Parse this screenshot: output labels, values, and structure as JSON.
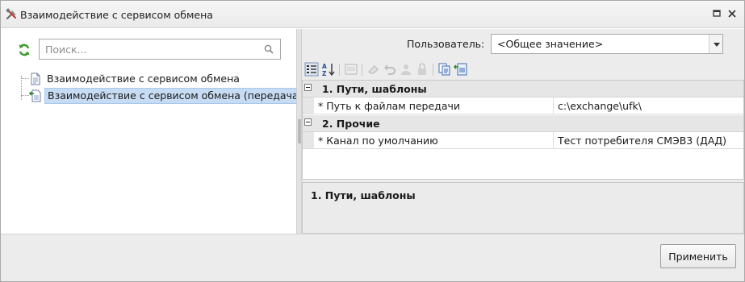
{
  "window": {
    "title": "Взаимодействие с сервисом обмена",
    "icon": "tools-icon"
  },
  "left": {
    "search_placeholder": "Поиск...",
    "tree": [
      {
        "label": "Взаимодействие с сервисом обмена",
        "icon": "document-icon",
        "selected": false
      },
      {
        "label": "Взаимодействие с сервисом обмена (передача)",
        "icon": "document-transfer-icon",
        "selected": true
      }
    ]
  },
  "right": {
    "user_label": "Пользователь:",
    "user_value": "<Общее значение>",
    "categories": [
      {
        "label": "1. Пути, шаблоны",
        "props": [
          {
            "name": "* Путь к файлам передачи",
            "value": "c:\\exchange\\ufk\\"
          }
        ]
      },
      {
        "label": "2. Прочие",
        "props": [
          {
            "name": "* Канал по умолчанию",
            "value": "Тест потребителя СМЭВ3 (ДАД)"
          }
        ]
      }
    ],
    "description_title": "1. Пути, шаблоны"
  },
  "buttons": {
    "apply": "Применить"
  },
  "colors": {
    "selection": "#c7dcf3",
    "panel": "#ececec",
    "category_row": "#e6e6e6"
  }
}
